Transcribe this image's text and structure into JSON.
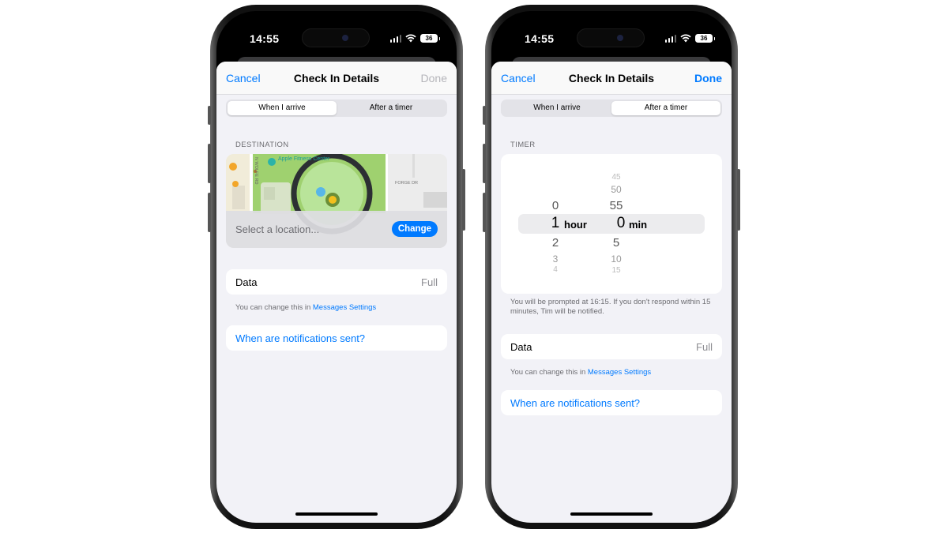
{
  "phones": [
    {
      "status": {
        "time": "14:55",
        "battery": "36"
      },
      "nav": {
        "cancel": "Cancel",
        "title": "Check In Details",
        "done": "Done"
      },
      "segments": [
        "When I arrive",
        "After a timer"
      ],
      "selected_segment": "When I arrive",
      "section_label": "DESTINATION",
      "map": {
        "labels": [
          "Apple Fitness Center",
          "N WOLFE RD",
          "FORGE DR"
        ]
      },
      "location": {
        "placeholder": "Select a location...",
        "change_label": "Change"
      },
      "data_row": {
        "label": "Data",
        "value": "Full"
      },
      "data_note": {
        "text": "You can change this in ",
        "link": "Messages Settings"
      },
      "notifications_link": "When are notifications sent?"
    },
    {
      "status": {
        "time": "14:55",
        "battery": "36"
      },
      "nav": {
        "cancel": "Cancel",
        "title": "Check In Details",
        "done": "Done"
      },
      "segments": [
        "When I arrive",
        "After a timer"
      ],
      "selected_segment": "After a timer",
      "section_label": "TIMER",
      "picker": {
        "hours": [
          "0",
          "1",
          "2",
          "3",
          "4"
        ],
        "selected_hour": "1",
        "hour_unit": "hour",
        "minutes": [
          "45",
          "50",
          "55",
          "0",
          "5",
          "10",
          "15"
        ],
        "selected_minute": "0",
        "minute_unit": "min"
      },
      "timer_note": "You will be prompted at 16:15. If you don't respond within 15 minutes, Tim will be notified.",
      "data_row": {
        "label": "Data",
        "value": "Full"
      },
      "data_note": {
        "text": "You can change this in ",
        "link": "Messages Settings"
      },
      "notifications_link": "When are notifications sent?"
    }
  ],
  "colors": {
    "accent": "#007aff",
    "sheet_bg": "#f2f2f7",
    "secondary_text": "#6d6d72"
  }
}
